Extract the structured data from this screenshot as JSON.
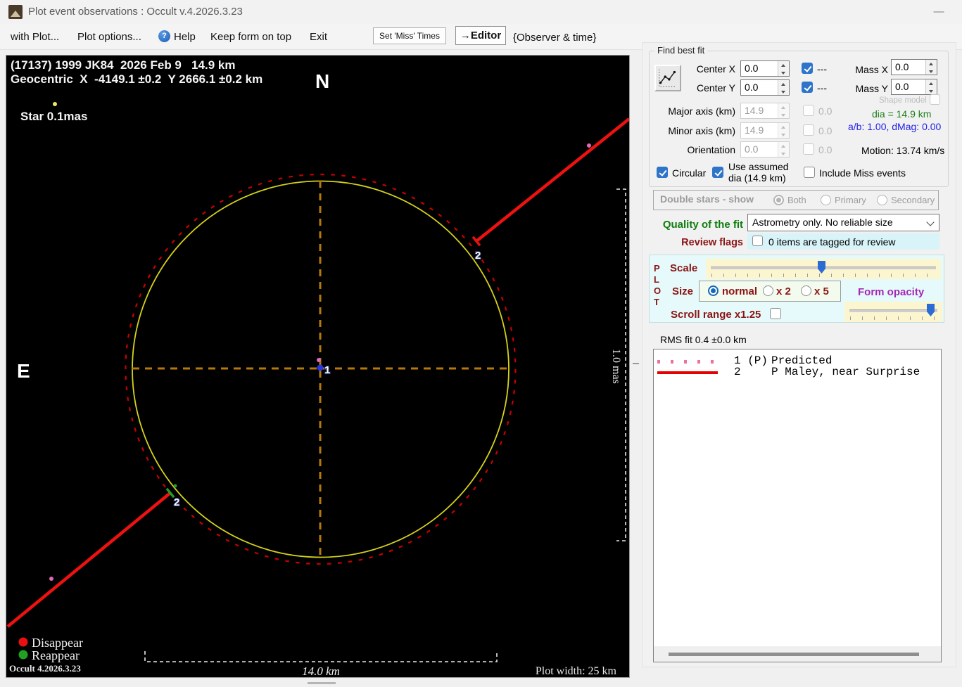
{
  "window": {
    "title": "Plot event observations : Occult v.4.2026.3.23",
    "minimize_glyph": "—"
  },
  "menubar": {
    "with_plot": "with Plot...",
    "plot_options": "Plot options...",
    "help": "Help",
    "help_glyph": "?",
    "keep_on_top": "Keep form on top",
    "exit": "Exit",
    "set_miss_times": "Set 'Miss' Times",
    "editor": "→Editor",
    "observer_time": "{Observer & time}"
  },
  "plot": {
    "title_line1": "(17137) 1999 JK84  2026 Feb 9   14.9 km",
    "title_line2": "Geocentric  X  -4149.1 ±0.2  Y 2666.1 ±0.2 km",
    "north": "N",
    "east": "E",
    "star_label": "Star 0.1mas",
    "center_chord_label": "1",
    "chord2_label": "2",
    "legend_disappear": "Disappear",
    "legend_reappear": "Reappear",
    "version": "Occult 4.2026.3.23",
    "scale_bar": "14.0 km",
    "mas_bar": "1.0 mas",
    "plot_width": "Plot width: 25 km",
    "colors": {
      "fitted_circle": "#d6d21a",
      "predicted_circle": "#c80000",
      "crosshair": "#b5790a",
      "chord": "#ee1111",
      "disappear": "#e81010",
      "reappear": "#22a022",
      "predicted_dot": "#e06ab8",
      "center_dot": "#2936e8",
      "star_dot": "#f0e960"
    }
  },
  "find_best_fit": {
    "title": "Find best fit",
    "center_x_label": "Center X",
    "center_x_value": "0.0",
    "center_x_dash": "---",
    "center_y_label": "Center Y",
    "center_y_value": "0.0",
    "center_y_dash": "---",
    "mass_x_label": "Mass X",
    "mass_x_value": "0.0",
    "mass_y_label": "Mass Y",
    "mass_y_value": "0.0",
    "shape_model_label": "Shape model",
    "major_axis_label": "Major axis (km)",
    "major_axis_value": "14.9",
    "major_axis_err": "0.0",
    "minor_axis_label": "Minor axis (km)",
    "minor_axis_value": "14.9",
    "minor_axis_err": "0.0",
    "orientation_label": "Orientation",
    "orientation_value": "0.0",
    "orientation_err": "0.0",
    "dia_text": "dia = 14.9 km",
    "ab_text": "a/b: 1.00, dMag: 0.00",
    "motion_text": "Motion: 13.74 km/s",
    "circular_label": "Circular",
    "use_assumed_line1": "Use assumed",
    "use_assumed_line2": "dia (14.9 km)",
    "include_miss_label": "Include Miss events"
  },
  "double_stars": {
    "label": "Double stars - show",
    "both": "Both",
    "primary": "Primary",
    "secondary": "Secondary"
  },
  "quality": {
    "label": "Quality of the fit",
    "value": "Astrometry only. No reliable size"
  },
  "review": {
    "label": "Review flags",
    "text": "0 items are tagged for review"
  },
  "plot_controls": {
    "p": "P",
    "l": "L",
    "o": "O",
    "t": "T",
    "scale_label": "Scale",
    "size_label": "Size",
    "size_normal": "normal",
    "size_x2": "x 2",
    "size_x5": "x 5",
    "form_opacity_label": "Form opacity",
    "scroll_range_label": "Scroll range x1.25",
    "scale_value_pct": 50,
    "opacity_value_pct": 95
  },
  "rms": {
    "label": "RMS fit 0.4 ±0.0 km"
  },
  "observations": {
    "items": [
      {
        "id": "1 (P)",
        "name": "Predicted",
        "style": "dotted",
        "color": "#ef6fa0"
      },
      {
        "id": "2",
        "name": "P Maley, near Surprise",
        "style": "solid",
        "color": "#e80000"
      }
    ]
  }
}
